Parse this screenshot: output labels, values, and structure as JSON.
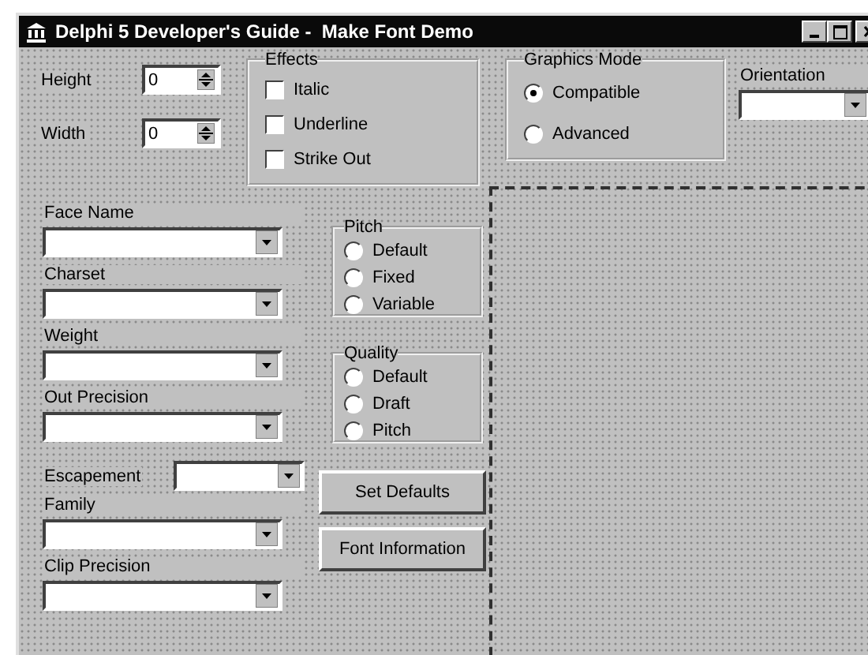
{
  "window": {
    "title": "Delphi 5 Developer's Guide -  Make Font Demo"
  },
  "spinners": [
    {
      "label": "Height",
      "value": "0"
    },
    {
      "label": "Width",
      "value": "0"
    }
  ],
  "effects": {
    "title": "Effects",
    "items": [
      {
        "label": "Italic",
        "checked": false
      },
      {
        "label": "Underline",
        "checked": false
      },
      {
        "label": "Strike Out",
        "checked": false
      }
    ]
  },
  "graphics_mode": {
    "title": "Graphics Mode",
    "options": [
      {
        "label": "Compatible",
        "selected": true
      },
      {
        "label": "Advanced",
        "selected": false
      }
    ]
  },
  "orientation": {
    "label": "Orientation"
  },
  "fields": [
    {
      "label": "Face Name",
      "kind": "stacked"
    },
    {
      "label": "Charset",
      "kind": "stacked"
    },
    {
      "label": "Weight",
      "kind": "stacked"
    },
    {
      "label": "Out Precision",
      "kind": "stacked"
    },
    {
      "label": "Escapement",
      "kind": "inline"
    },
    {
      "label": "Family",
      "kind": "stacked"
    },
    {
      "label": "Clip Precision",
      "kind": "stacked"
    }
  ],
  "pitch": {
    "title": "Pitch",
    "options": [
      {
        "label": "Default",
        "selected": false
      },
      {
        "label": "Fixed",
        "selected": false
      },
      {
        "label": "Variable",
        "selected": false
      }
    ]
  },
  "quality": {
    "title": "Quality",
    "options": [
      {
        "label": "Default",
        "selected": false
      },
      {
        "label": "Draft",
        "selected": false
      },
      {
        "label": "Pitch",
        "selected": false
      }
    ]
  },
  "buttons": [
    "Set Defaults",
    "Font Information"
  ]
}
